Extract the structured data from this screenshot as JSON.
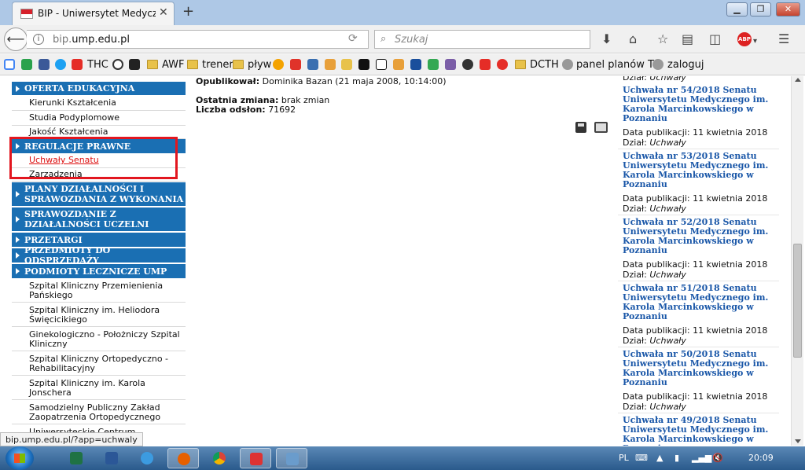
{
  "browser": {
    "tab_title": "BIP - Uniwersytet Medyczn...",
    "url_prefix": "bip.",
    "url_domain": "ump.edu.pl",
    "search_placeholder": "Szukaj",
    "abp_label": "ABP"
  },
  "bookmarks": [
    {
      "label": "THC"
    },
    {
      "label": "AWF"
    },
    {
      "label": "trener"
    },
    {
      "label": "pływ"
    },
    {
      "label": "DCTH"
    },
    {
      "label": "panel planów TO"
    },
    {
      "label": "zaloguj"
    }
  ],
  "sidebar": {
    "categories": [
      {
        "label": "OFERTA EDUKACYJNA"
      },
      {
        "label": "REGULACJE PRAWNE"
      },
      {
        "label": "PLANY DZIAŁALNOŚCI I SPRAWOZDANIA Z WYKONANIA"
      },
      {
        "label": "SPRAWOZDANIE Z DZIAŁALNOŚCI UCZELNI"
      },
      {
        "label": "PRZETARGI"
      },
      {
        "label": "PRZEDMIOTY DO ODSPRZEDAŻY"
      },
      {
        "label": "PODMIOTY LECZNICZE UMP"
      }
    ],
    "subitems": [
      {
        "label": "Kierunki Kształcenia"
      },
      {
        "label": "Studia Podyplomowe"
      },
      {
        "label": "Jakość Kształcenia"
      },
      {
        "label": "Uchwały Senatu"
      },
      {
        "label": "Zarządzenia"
      },
      {
        "label": "Szpital Kliniczny Przemienienia Pańskiego"
      },
      {
        "label": "Szpital Kliniczny im. Heliodora Święcicikiego"
      },
      {
        "label": "Ginekologiczno - Położniczy Szpital Kliniczny"
      },
      {
        "label": "Szpital Kliniczny Ortopedyczno - Rehabilitacyjny"
      },
      {
        "label": "Szpital Kliniczny im. Karola Jonschera"
      },
      {
        "label": "Samodzielny Publiczny Zakład Zaopatrzenia Ortopedycznego"
      },
      {
        "label": "Uniwersyteckie Centrum"
      }
    ]
  },
  "main": {
    "published_label": "Opublikował:",
    "published_value": "Dominika Bazan (21 maja 2008, 10:14:00)",
    "last_change_label": "Ostatnia zmiana:",
    "last_change_value": "brak zmian",
    "views_label": "Liczba odsłon:",
    "views_value": "71692"
  },
  "news": {
    "top_dept_label": "Dział:",
    "top_dept_value": "Uchwały",
    "items": [
      {
        "title": "Uchwała nr 54/2018 Senatu Uniwersytetu Medycznego im. Karola Marcinkowskiego w Poznaniu",
        "date": "Data publikacji: 11 kwietnia 2018",
        "dept_label": "Dział:",
        "dept_value": "Uchwały"
      },
      {
        "title": "Uchwała nr 53/2018 Senatu Uniwersytetu Medycznego im. Karola Marcinkowskiego w Poznaniu",
        "date": "Data publikacji: 11 kwietnia 2018",
        "dept_label": "Dział:",
        "dept_value": "Uchwały"
      },
      {
        "title": "Uchwała nr 52/2018 Senatu Uniwersytetu Medycznego im. Karola Marcinkowskiego w Poznaniu",
        "date": "Data publikacji: 11 kwietnia 2018",
        "dept_label": "Dział:",
        "dept_value": "Uchwały"
      },
      {
        "title": "Uchwała nr 51/2018 Senatu Uniwersytetu Medycznego im. Karola Marcinkowskiego w Poznaniu",
        "date": "Data publikacji: 11 kwietnia 2018",
        "dept_label": "Dział:",
        "dept_value": "Uchwały"
      },
      {
        "title": "Uchwała nr 50/2018 Senatu Uniwersytetu Medycznego im. Karola Marcinkowskiego w Poznaniu",
        "date": "Data publikacji: 11 kwietnia 2018",
        "dept_label": "Dział:",
        "dept_value": "Uchwały"
      },
      {
        "title": "Uchwała nr 49/2018 Senatu Uniwersytetu Medycznego im. Karola Marcinkowskiego w Poznaniu"
      }
    ]
  },
  "status_link": "bip.ump.edu.pl/?app=uchwaly",
  "taskbar": {
    "language": "PL",
    "clock": "20:09"
  },
  "colors": {
    "nav_blue": "#1a6fb3",
    "link_blue": "#1a57a8",
    "active_red": "#d11111",
    "highlight_red": "#e2161f"
  }
}
